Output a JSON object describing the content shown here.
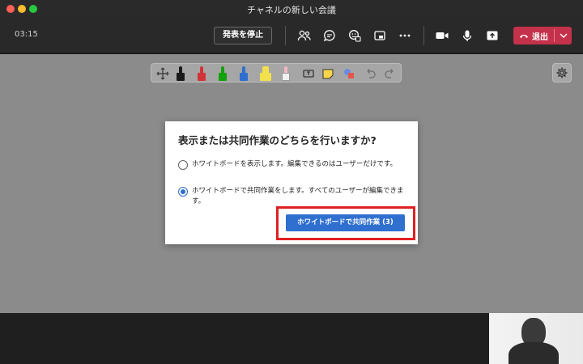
{
  "window": {
    "title": "チャネルの新しい会議"
  },
  "toolbar": {
    "timer": "03:15",
    "stop_presenting_label": "発表を停止",
    "icons": [
      "people-icon",
      "chat-icon",
      "reactions-icon",
      "share-tray-icon",
      "more-icon",
      "camera-icon",
      "mic-icon",
      "share-icon"
    ],
    "leave_label": "退出",
    "leave_color": "#c4314b"
  },
  "whiteboard": {
    "tools": [
      "move-icon",
      "black-pen",
      "red-pen",
      "green-pen",
      "blue-pen",
      "yellow-highlighter",
      "eraser",
      "text-icon",
      "sticky-note-icon",
      "shapes-icon",
      "undo-icon",
      "redo-icon"
    ],
    "pen_colors": [
      "#1a1a1a",
      "#d13438",
      "#13a10e",
      "#2f6fcf",
      "#f2e14c",
      "#f4b6c2"
    ]
  },
  "dialog": {
    "title": "表示または共同作業のどちらを行いますか?",
    "options": [
      {
        "label": "ホワイトボードを表示します。編集できるのはユーザーだけです。",
        "selected": false
      },
      {
        "label": "ホワイトボードで共同作業をします。すべてのユーザーが編集できます。",
        "selected": true
      }
    ],
    "primary_button": "ホワイトボードで共同作業 (3)",
    "accent": "#2f6fcf"
  }
}
